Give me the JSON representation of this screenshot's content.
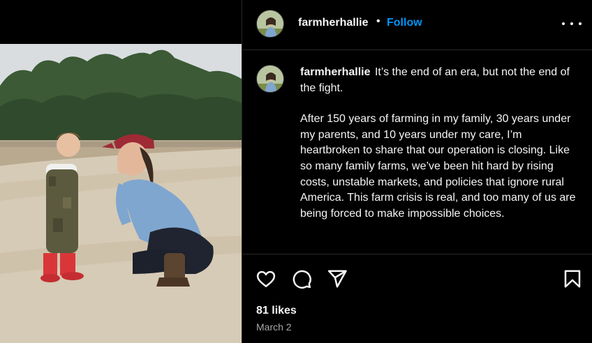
{
  "post": {
    "username": "farmherhallie",
    "separator": "•",
    "follow_label": "Follow",
    "caption_line1": "It’s the end of an era, but not the end of the fight.",
    "caption_body": "After 150 years of farming in my family, 30 years under my parents, and 10 years under my care, I’m heartbroken to share that our operation is closing. Like so many family farms, we’ve been hit hard by rising costs, unstable markets, and policies that ignore rural America. This farm crisis is real, and too many of us are being forced to make impossible choices.",
    "likes": "81 likes",
    "date": "March 2"
  },
  "icons": {
    "more": "more-options-icon",
    "like": "heart-icon",
    "comment": "comment-icon",
    "share": "paper-plane-icon",
    "save": "bookmark-icon"
  },
  "colors": {
    "background": "#000000",
    "text": "#f5f5f5",
    "link": "#0095f6",
    "muted": "#a8a8a8",
    "divider": "#262626"
  }
}
